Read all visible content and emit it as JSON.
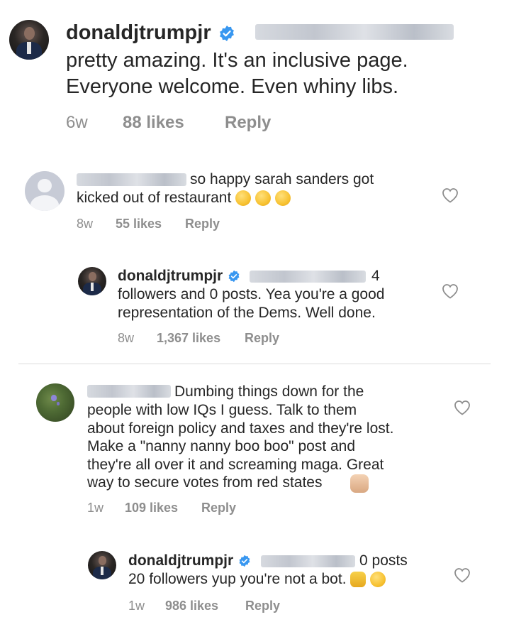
{
  "top_comment": {
    "username": "donaldjtrumpjr",
    "text": "pretty amazing. It's an inclusive page.\nEveryone welcome. Even whiny libs.",
    "time": "6w",
    "likes": "88 likes",
    "reply": "Reply"
  },
  "comment1": {
    "text_line1": "so happy sarah sanders got",
    "text_line2": "kicked out of restaurant",
    "time": "8w",
    "likes": "55 likes",
    "reply": "Reply"
  },
  "reply1": {
    "username": "donaldjtrumpjr",
    "text_tail": "4",
    "text": "followers and 0 posts. Yea you're a good\nrepresentation of the Dems. Well done.",
    "time": "8w",
    "likes": "1,367 likes",
    "reply": "Reply"
  },
  "comment2": {
    "text_line1": "Dumbing things down for the",
    "text": "people with low IQs I guess. Talk to them\nabout foreign policy and taxes and they're lost.\nMake a \"nanny nanny boo boo\" post and\nthey're all over it and screaming maga. Great\nway to secure votes from red states",
    "time": "1w",
    "likes": "109 likes",
    "reply": "Reply"
  },
  "reply2": {
    "username": "donaldjtrumpjr",
    "text_tail": "0 posts",
    "text": "20 followers yup you're not a bot.",
    "time": "1w",
    "likes": "986 likes",
    "reply": "Reply"
  },
  "icons": {
    "verified": "verified-badge-icon",
    "like": "heart-outline-icon"
  },
  "colors": {
    "verified_blue": "#3897f0",
    "meta_gray": "#8e8e8e",
    "text": "#262626"
  }
}
